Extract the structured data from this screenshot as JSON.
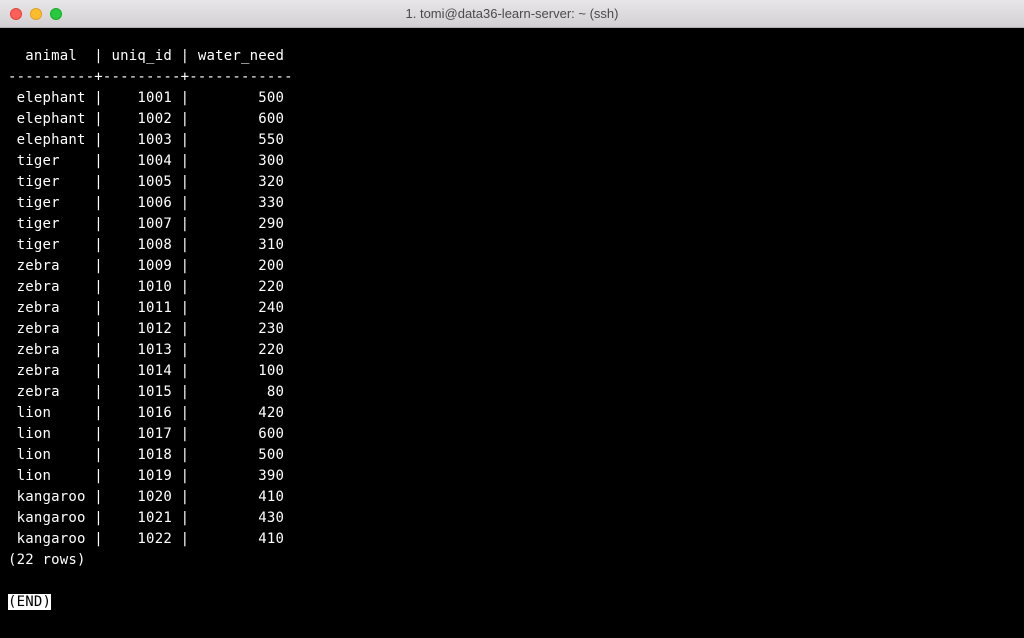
{
  "window": {
    "title": "1. tomi@data36-learn-server: ~ (ssh)"
  },
  "columns": {
    "col1": "animal",
    "col2": "uniq_id",
    "col3": "water_need"
  },
  "col_widths": {
    "col1": 10,
    "col2": 9,
    "col3": 12
  },
  "rows": [
    {
      "animal": "elephant",
      "uniq_id": "1001",
      "water_need": "500"
    },
    {
      "animal": "elephant",
      "uniq_id": "1002",
      "water_need": "600"
    },
    {
      "animal": "elephant",
      "uniq_id": "1003",
      "water_need": "550"
    },
    {
      "animal": "tiger",
      "uniq_id": "1004",
      "water_need": "300"
    },
    {
      "animal": "tiger",
      "uniq_id": "1005",
      "water_need": "320"
    },
    {
      "animal": "tiger",
      "uniq_id": "1006",
      "water_need": "330"
    },
    {
      "animal": "tiger",
      "uniq_id": "1007",
      "water_need": "290"
    },
    {
      "animal": "tiger",
      "uniq_id": "1008",
      "water_need": "310"
    },
    {
      "animal": "zebra",
      "uniq_id": "1009",
      "water_need": "200"
    },
    {
      "animal": "zebra",
      "uniq_id": "1010",
      "water_need": "220"
    },
    {
      "animal": "zebra",
      "uniq_id": "1011",
      "water_need": "240"
    },
    {
      "animal": "zebra",
      "uniq_id": "1012",
      "water_need": "230"
    },
    {
      "animal": "zebra",
      "uniq_id": "1013",
      "water_need": "220"
    },
    {
      "animal": "zebra",
      "uniq_id": "1014",
      "water_need": "100"
    },
    {
      "animal": "zebra",
      "uniq_id": "1015",
      "water_need": "80"
    },
    {
      "animal": "lion",
      "uniq_id": "1016",
      "water_need": "420"
    },
    {
      "animal": "lion",
      "uniq_id": "1017",
      "water_need": "600"
    },
    {
      "animal": "lion",
      "uniq_id": "1018",
      "water_need": "500"
    },
    {
      "animal": "lion",
      "uniq_id": "1019",
      "water_need": "390"
    },
    {
      "animal": "kangaroo",
      "uniq_id": "1020",
      "water_need": "410"
    },
    {
      "animal": "kangaroo",
      "uniq_id": "1021",
      "water_need": "430"
    },
    {
      "animal": "kangaroo",
      "uniq_id": "1022",
      "water_need": "410"
    }
  ],
  "footer": {
    "row_count": "(22 rows)",
    "pager_end": "(END)"
  }
}
